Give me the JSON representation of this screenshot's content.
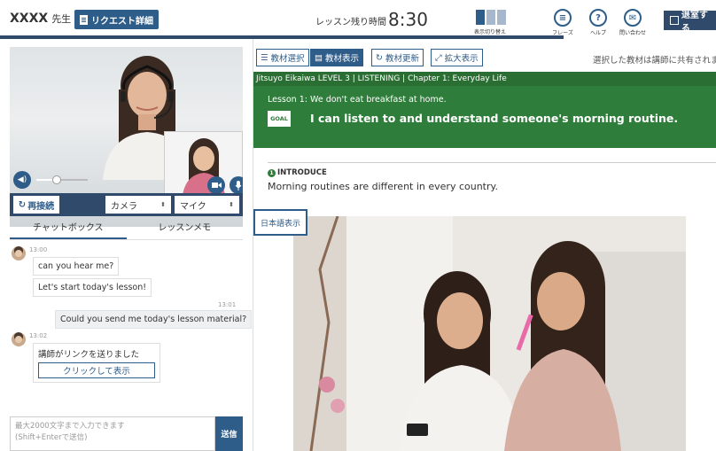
{
  "header": {
    "teacher_name": "XXXX",
    "teacher_suffix": "先生",
    "request_button": "リクエスト詳細",
    "remaining_label": "レッスン残り時間",
    "timer": "8:30",
    "layout_toggle_label": "表示切り替え",
    "phrase_label": "フレーズ",
    "help_label": "ヘルプ",
    "contact_label": "問い合わせ",
    "exit_button": "退室する"
  },
  "video": {
    "reconnect_label": "再接続",
    "camera_select": "カメラ",
    "mic_select": "マイク",
    "volume_level": 0.4
  },
  "tabs": {
    "chat": "チャットボックス",
    "memo": "レッスンメモ"
  },
  "chat": {
    "messages": [
      {
        "time": "13:00",
        "text": "can you hear me?"
      },
      {
        "text": "Let's start today's lesson!"
      },
      {
        "time": "13:01",
        "text": "Could you send me today's lesson material?"
      },
      {
        "time": "13:02",
        "text": "講師がリンクを送りました",
        "link": "クリックして表示"
      }
    ],
    "input_placeholder_line1": "最大2000文字まで入力できます",
    "input_placeholder_line2": "(Shift+Enterで送信)",
    "send_button": "送信"
  },
  "material": {
    "toolbar": {
      "select_label": "教材選択",
      "display_label": "教材表示",
      "refresh_label": "教材更新",
      "expand_label": "拡大表示",
      "share_note": "選択した教材は講師に共有されます"
    },
    "breadcrumb": "Jitsuyo Eikaiwa LEVEL 3 | LISTENING | Chapter 1: Everyday Life",
    "lesson_title": "Lesson 1: We don't eat breakfast at home.",
    "goal_badge": "GOAL",
    "goal_text": "I can listen to and understand someone's morning routine.",
    "section_number": "1",
    "section_label": "INTRODUCE",
    "section_text": "Morning routines are different in every country.",
    "japanese_button": "日本語表示"
  },
  "colors": {
    "primary": "#2f5d8a",
    "dark": "#2f4a6a",
    "green": "#2e7d3a"
  }
}
